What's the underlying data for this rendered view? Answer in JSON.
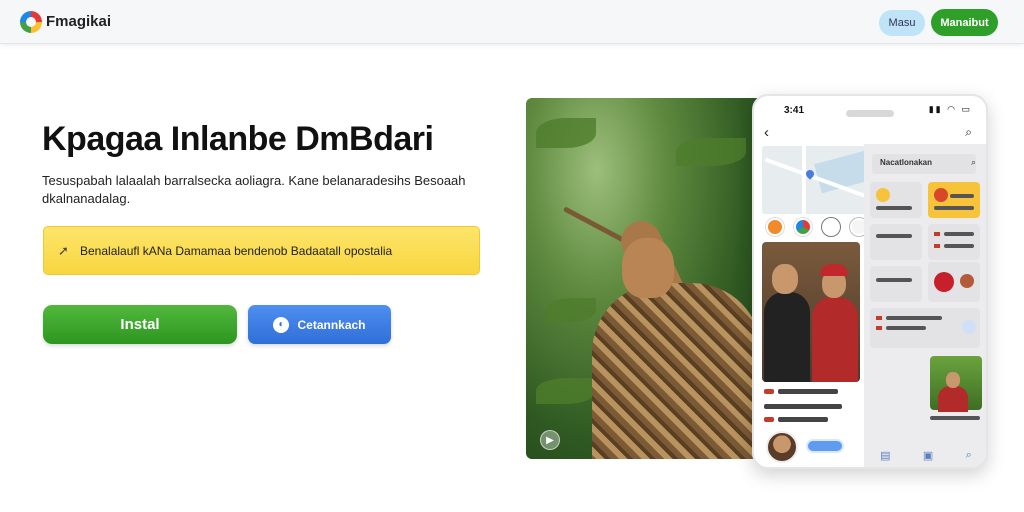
{
  "header": {
    "brand": "Fmagikai",
    "login_label": "Masu",
    "signup_label": "Manaibut"
  },
  "hero": {
    "title": "Kpagaa Inlanbe DmBdari",
    "description": "Tesuspabah lalaalah barralsecka aoliagra. Kane belanaradesihs Besoaah dkalnanadalag.",
    "notice": "Benalalaufl kANa Damamaa bendenob Badaatall opostalia",
    "install_label": "Instal",
    "contact_label": "Cetannkach"
  },
  "photo": {
    "badge_icon": "play-icon"
  },
  "phone": {
    "time": "3:41",
    "status_icons": "signal-wifi-battery",
    "panel_title": "Nacatlonakan"
  },
  "colors": {
    "install_green": "#2ea02a",
    "contact_blue": "#3a78e0",
    "notice_yellow": "#f9dc4e",
    "login_blue": "#bfe3f7"
  }
}
